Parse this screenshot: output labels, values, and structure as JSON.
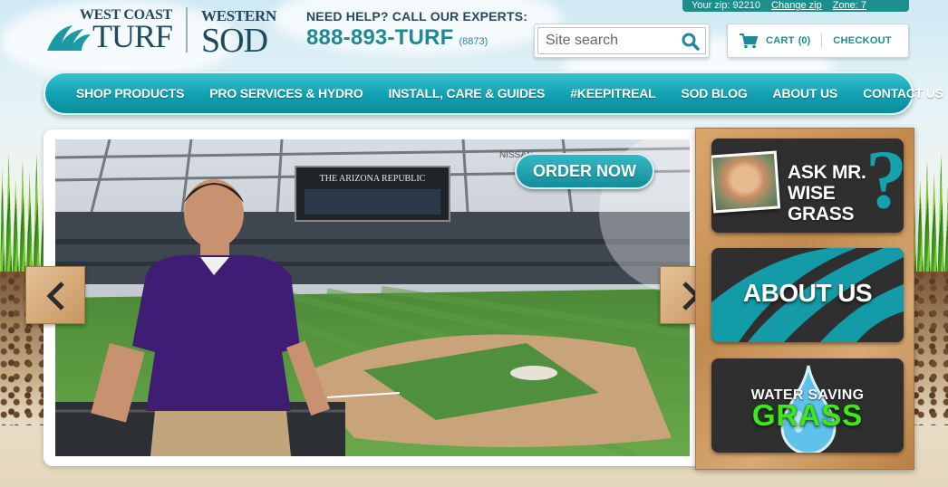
{
  "top_strip": {
    "zip_text": "Your zip: 92210",
    "change_zip": "Change zip",
    "extra": "Zone: 7"
  },
  "logo_wct": {
    "top": "WEST COAST",
    "bottom": "TURF"
  },
  "logo_ws": {
    "top": "WESTERN",
    "bottom": "SOD"
  },
  "help": {
    "label": "NEED HELP? CALL OUR EXPERTS:",
    "phone": "888-893-TURF",
    "digits": "(8873)"
  },
  "search": {
    "placeholder": "Site search",
    "icon": "search-icon"
  },
  "cart": {
    "label": "CART",
    "count": "(0)",
    "checkout": "CHECKOUT",
    "icon": "cart-icon"
  },
  "nav": {
    "items": [
      "SHOP PRODUCTS",
      "PRO SERVICES & HYDRO",
      "INSTALL, CARE & GUIDES",
      "#KEEPITREAL",
      "SOD BLOG",
      "ABOUT US",
      "CONTACT US"
    ]
  },
  "slider": {
    "order_button": "ORDER NOW",
    "scoreboard_text": "THE ARIZONA REPUBLIC",
    "sponsor_text": "NISSAN",
    "prev_icon": "chevron-left-icon",
    "next_icon": "chevron-right-icon"
  },
  "promos": {
    "ask": {
      "line1": "ASK MR.",
      "line2": "WISE GRASS",
      "mark": "?"
    },
    "about": {
      "label": "ABOUT US"
    },
    "water": {
      "line1": "WATER SAVING",
      "line2": "GRASS"
    }
  },
  "colors": {
    "teal_accent": "#1f8a95",
    "nav_teal": "#13a3b2",
    "dark_navy": "#244c5e",
    "water_green": "#3fe81c"
  }
}
